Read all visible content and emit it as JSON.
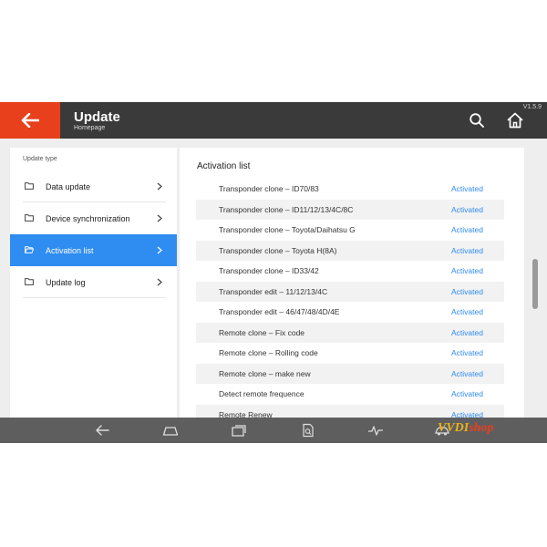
{
  "header": {
    "title": "Update",
    "subtitle": "Homepage",
    "version": "V1.5.9"
  },
  "left_panel": {
    "header": "Update type",
    "items": [
      {
        "label": "Data update"
      },
      {
        "label": "Device synchronization"
      },
      {
        "label": "Activation list",
        "active": true
      },
      {
        "label": "Update log"
      }
    ]
  },
  "right_panel": {
    "title": "Activation list",
    "rows": [
      {
        "name": "Transponder clone – ID70/83",
        "status": "Activated"
      },
      {
        "name": "Transponder clone – ID11/12/13/4C/8C",
        "status": "Activated"
      },
      {
        "name": "Transponder clone – Toyota/Daihatsu G",
        "status": "Activated"
      },
      {
        "name": "Transponder clone – Toyota H(8A)",
        "status": "Activated"
      },
      {
        "name": "Transponder clone – ID33/42",
        "status": "Activated"
      },
      {
        "name": "Transponder edit – 11/12/13/4C",
        "status": "Activated"
      },
      {
        "name": "Transponder edit – 46/47/48/4D/4E",
        "status": "Activated"
      },
      {
        "name": "Remote clone – Fix code",
        "status": "Activated"
      },
      {
        "name": "Remote clone – Rolling code",
        "status": "Activated"
      },
      {
        "name": "Remote clone – make new",
        "status": "Activated"
      },
      {
        "name": "Detect remote frequence",
        "status": "Activated"
      },
      {
        "name": "Remote Renew",
        "status": "Activated"
      }
    ]
  },
  "watermark": {
    "part1": "VVDI",
    "part2": "shop"
  },
  "colors": {
    "accent_red": "#e8401c",
    "accent_blue": "#2f8cf0",
    "header_bg": "#3a3a3a"
  },
  "icons": [
    "back-arrow-icon",
    "search-icon",
    "home-icon",
    "folder-icon",
    "chevron-right-icon",
    "nav-back-icon",
    "nav-home-icon",
    "nav-recents-icon",
    "nav-search-doc-icon",
    "nav-pulse-icon",
    "nav-car-icon"
  ]
}
